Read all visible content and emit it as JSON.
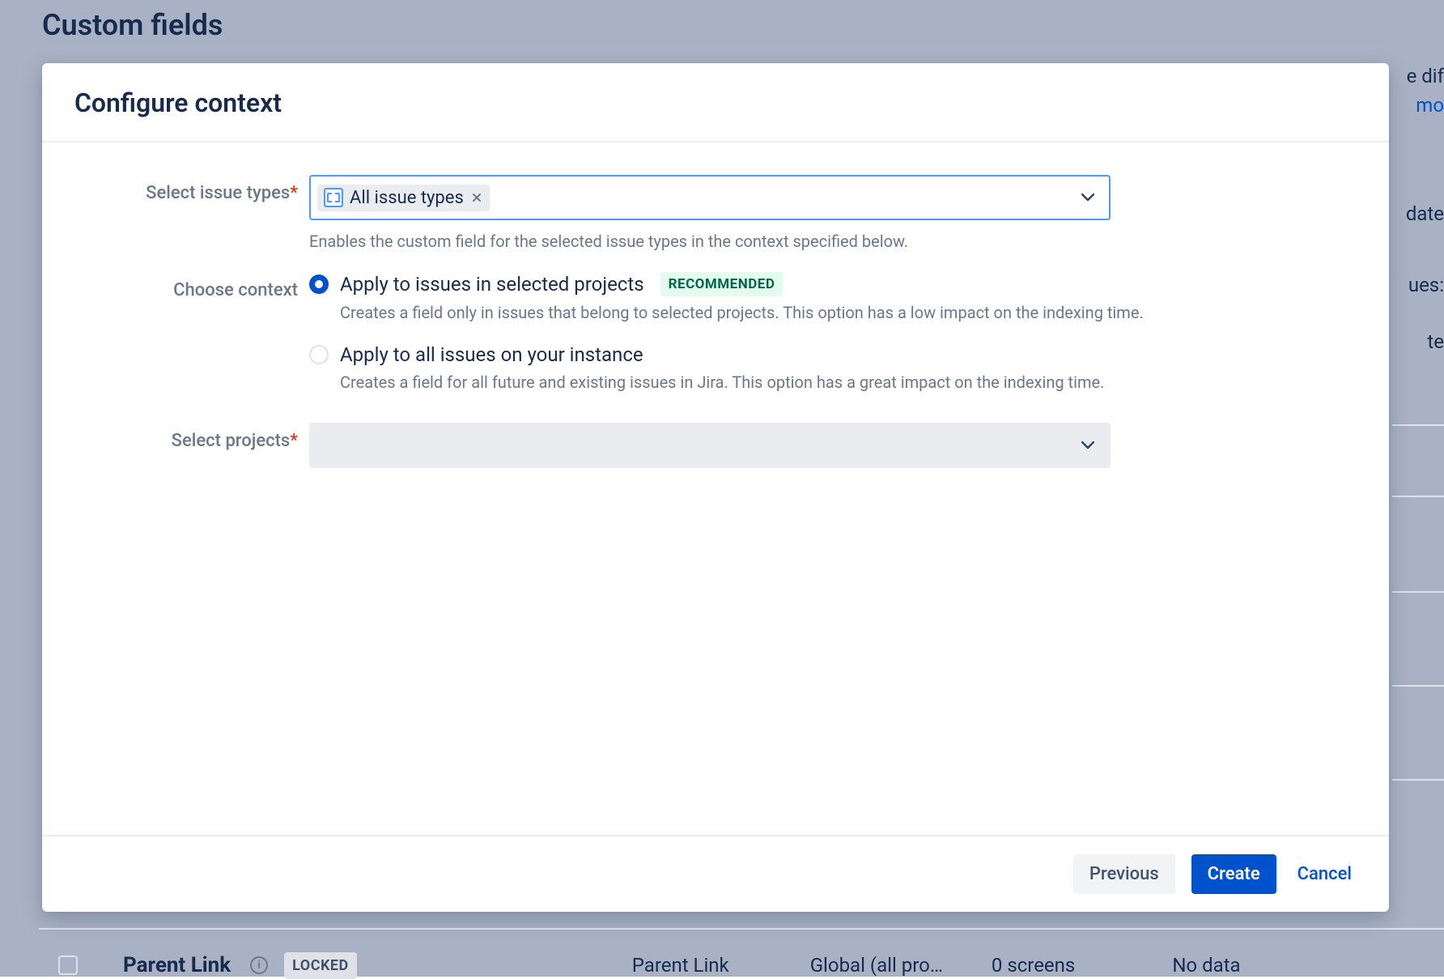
{
  "background": {
    "page_title": "Custom fields",
    "side_fragments": {
      "t1": "e dif",
      "t2": "mo",
      "t3": "date",
      "t4": "ues:",
      "t5": "te"
    },
    "row": {
      "name": "Parent Link",
      "locked_label": "LOCKED",
      "type": "Parent Link",
      "context": "Global (all pro…",
      "screens": "0 screens",
      "data": "No data"
    }
  },
  "modal": {
    "title": "Configure context",
    "issue_types": {
      "label": "Select issue types",
      "selected_chip": "All issue types",
      "help": "Enables the custom field for the selected issue types in the context specified below."
    },
    "context": {
      "label": "Choose context",
      "option1": {
        "label": "Apply to issues in selected projects",
        "badge": "RECOMMENDED",
        "help": "Creates a field only in issues that belong to selected projects. This option has a low impact on the indexing time."
      },
      "option2": {
        "label": "Apply to all issues on your instance",
        "help": "Creates a field for all future and existing issues in Jira. This option has a great impact on the indexing time."
      }
    },
    "projects": {
      "label": "Select projects"
    },
    "footer": {
      "previous": "Previous",
      "create": "Create",
      "cancel": "Cancel"
    }
  }
}
